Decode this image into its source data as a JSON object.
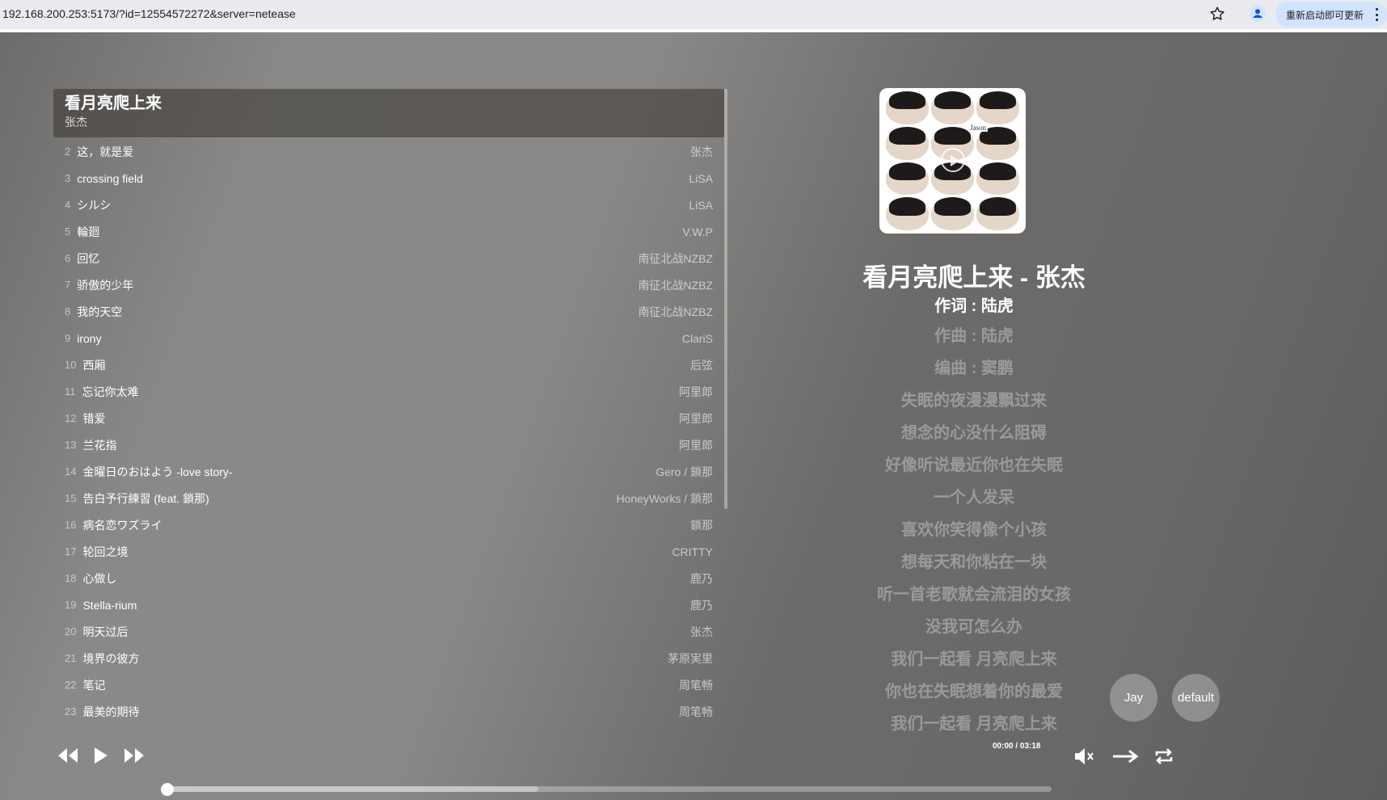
{
  "browser": {
    "url": "192.168.200.253:5173/?id=12554572272&server=netease",
    "update_label": "重新启动即可更新"
  },
  "player": {
    "current": {
      "title": "看月亮爬上来",
      "artist": "张杰"
    },
    "playlist": [
      {
        "num": "2",
        "name": "这，就是爱",
        "artist": "张杰"
      },
      {
        "num": "3",
        "name": "crossing field",
        "artist": "LiSA"
      },
      {
        "num": "4",
        "name": "シルシ",
        "artist": "LiSA"
      },
      {
        "num": "5",
        "name": "輪廻",
        "artist": "V.W.P"
      },
      {
        "num": "6",
        "name": "回忆",
        "artist": "南征北战NZBZ"
      },
      {
        "num": "7",
        "name": "骄傲的少年",
        "artist": "南征北战NZBZ"
      },
      {
        "num": "8",
        "name": "我的天空",
        "artist": "南征北战NZBZ"
      },
      {
        "num": "9",
        "name": "irony",
        "artist": "ClariS"
      },
      {
        "num": "10",
        "name": "西厢",
        "artist": "后弦"
      },
      {
        "num": "11",
        "name": "忘记你太难",
        "artist": "阿里郎"
      },
      {
        "num": "12",
        "name": "错爱",
        "artist": "阿里郎"
      },
      {
        "num": "13",
        "name": "兰花指",
        "artist": "阿里郎"
      },
      {
        "num": "14",
        "name": "金曜日のおはよう -love story-",
        "artist": "Gero / 鎖那"
      },
      {
        "num": "15",
        "name": "告白予行練習 (feat. 鎖那)",
        "artist": "HoneyWorks / 鎖那"
      },
      {
        "num": "16",
        "name": "病名恋ワズライ",
        "artist": "鎖那"
      },
      {
        "num": "17",
        "name": "轮回之境",
        "artist": "CRITTY"
      },
      {
        "num": "18",
        "name": "心做し",
        "artist": "鹿乃"
      },
      {
        "num": "19",
        "name": "Stella-rium",
        "artist": "鹿乃"
      },
      {
        "num": "20",
        "name": "明天过后",
        "artist": "张杰"
      },
      {
        "num": "21",
        "name": "境界の彼方",
        "artist": "茅原実里"
      },
      {
        "num": "22",
        "name": "笔记",
        "artist": "周笔畅"
      },
      {
        "num": "23",
        "name": "最美的期待",
        "artist": "周笔畅"
      }
    ],
    "now_playing_title": "看月亮爬上来 - 张杰",
    "lyrics": [
      "作词 : 陆虎",
      "作曲 : 陆虎",
      "编曲 : 窦鹏",
      "失眠的夜漫漫飘过来",
      "想念的心没什么阻碍",
      "好像听说最近你也在失眠",
      "一个人发呆",
      "喜欢你笑得像个小孩",
      "想每天和你粘在一块",
      "听一首老歌就会流泪的女孩",
      "没我可怎么办",
      "我们一起看 月亮爬上来",
      "你也在失眠想着你的最爱",
      "我们一起看 月亮爬上来"
    ],
    "theme_buttons": {
      "jay": "Jay",
      "default": "default"
    },
    "time_display": "00:00 / 03:18",
    "progress": 0,
    "buffered": 0.42
  },
  "icons": {
    "star": "star-icon",
    "profile": "profile-icon",
    "prev": "rewind-icon",
    "play": "play-icon",
    "next": "fast-forward-icon",
    "volume": "volume-muted-icon",
    "order": "arrow-right-icon",
    "repeat": "repeat-icon"
  }
}
